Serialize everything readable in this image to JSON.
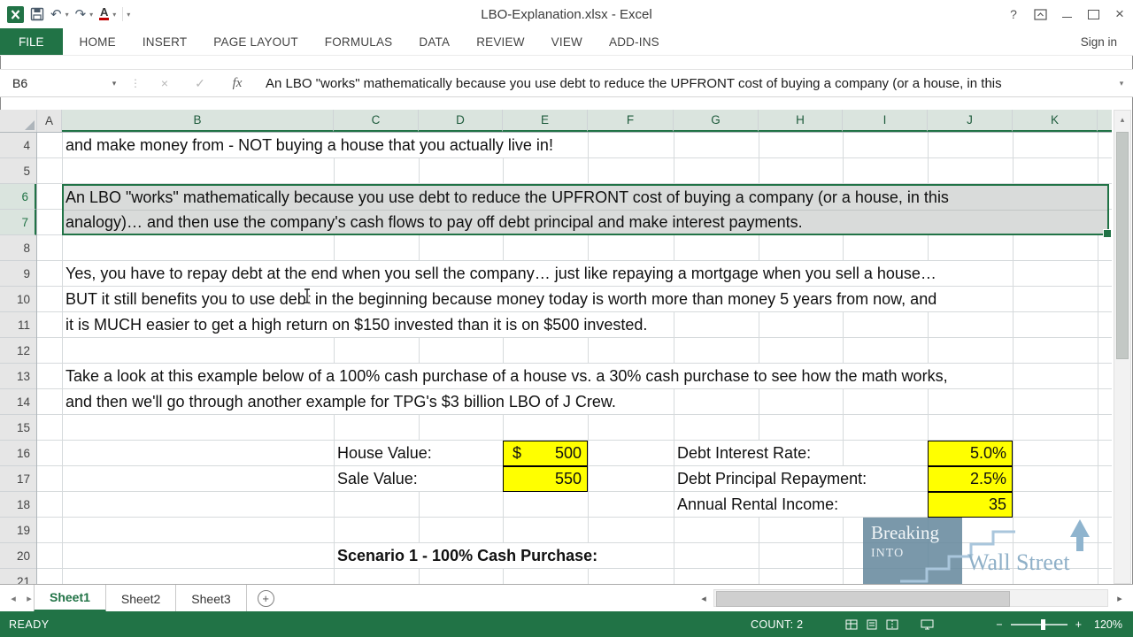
{
  "titlebar": {
    "title": "LBO-Explanation.xlsx - Excel"
  },
  "icons": {
    "undo": "↶",
    "redo": "↷",
    "dropdown": "▾",
    "font_color_letter": "A",
    "help": "?",
    "close": "×",
    "name_dropdown": "▾",
    "formula_cancel": "×",
    "formula_check": "✓",
    "handle_dots": "⋮",
    "sheet_nav_left": "◂",
    "sheet_nav_right": "▸",
    "add_sheet": "+",
    "scroll_left": "◂",
    "scroll_right": "▸",
    "scroll_up": "▴",
    "zoom_out": "−",
    "zoom_in": "+"
  },
  "ribbon": {
    "tabs": [
      "FILE",
      "HOME",
      "INSERT",
      "PAGE LAYOUT",
      "FORMULAS",
      "DATA",
      "REVIEW",
      "VIEW",
      "ADD-INS"
    ],
    "sign_in": "Sign in"
  },
  "formula_bar": {
    "name_box": "B6",
    "fx_label": "fx",
    "content": "An LBO \"works\" mathematically because you use debt to reduce the UPFRONT cost of buying a company (or a house, in this"
  },
  "sheet": {
    "col_headers": [
      "A",
      "B",
      "C",
      "D",
      "E",
      "F",
      "G",
      "H",
      "I",
      "J",
      "K"
    ],
    "row_headers": [
      "4",
      "5",
      "6",
      "7",
      "8",
      "9",
      "10",
      "11",
      "12",
      "13",
      "14",
      "15",
      "16",
      "17",
      "18",
      "19",
      "20",
      "21"
    ],
    "cells": {
      "b4": "and make money from - NOT buying a house that you actually live in!",
      "b6": "An LBO \"works\" mathematically because you use debt to reduce the UPFRONT cost of buying a company (or a house, in this",
      "b7": "analogy)… and then use the company's cash flows to pay off debt principal and make interest payments.",
      "b9": "Yes, you have to repay debt at the end when you sell the company… just like repaying a mortgage when you sell a house…",
      "b10": "BUT it still benefits you to use debt in the beginning because money today is worth more than money 5 years from now, and",
      "b11": "it is MUCH easier to get a high return on $150 invested than it is on $500 invested.",
      "b13": "Take a look at this example below of a 100% cash purchase of a house vs. a 30% cash purchase to see how the math works,",
      "b14": "and then we'll go through another example for TPG's $3 billion LBO of J Crew.",
      "c16": "House Value:",
      "c17": "Sale Value:",
      "e16_currency": "$",
      "e16": "500",
      "e17": "550",
      "g16": "Debt Interest Rate:",
      "g17": "Debt Principal Repayment:",
      "g18": "Annual Rental Income:",
      "j16": "5.0%",
      "j17": "2.5%",
      "j18": "35",
      "c20": "Scenario 1 - 100% Cash Purchase:"
    }
  },
  "sheet_tabs": {
    "sheet1": "Sheet1",
    "sheet2": "Sheet2",
    "sheet3": "Sheet3"
  },
  "status_bar": {
    "mode": "READY",
    "count": "COUNT: 2",
    "zoom": "120%"
  },
  "watermark": {
    "breaking": "Breaking",
    "into": "INTO",
    "wall_street": "Wall Street"
  },
  "colors": {
    "excel_green": "#217346",
    "highlight_yellow": "#FFFF00",
    "selection_gray": "#D9DBDA"
  }
}
